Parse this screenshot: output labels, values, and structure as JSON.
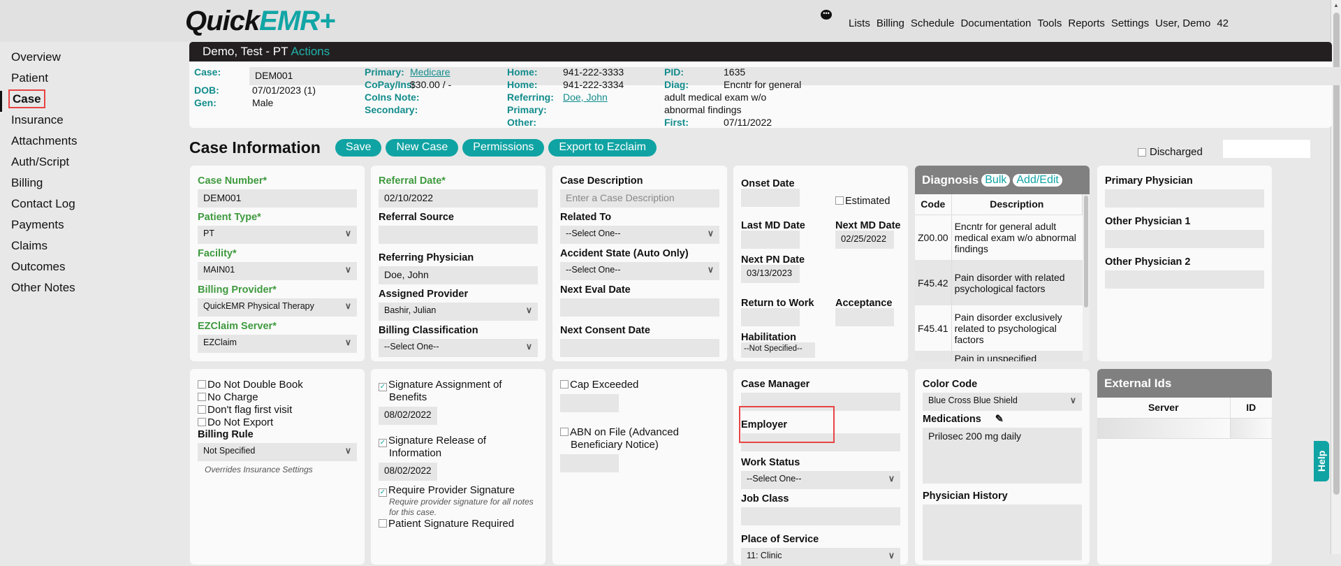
{
  "app": {
    "logo_a": "Quick",
    "logo_b": "EMR+",
    "brand_color": "#10a3a3"
  },
  "nav": [
    "Lists",
    "Billing",
    "Schedule",
    "Documentation",
    "Tools",
    "Reports",
    "Settings",
    "User, Demo",
    "42"
  ],
  "sidebar": [
    "Overview",
    "Patient",
    "Case",
    "Insurance",
    "Attachments",
    "Auth/Script",
    "Billing",
    "Contact Log",
    "Payments",
    "Claims",
    "Outcomes",
    "Other Notes"
  ],
  "patient": {
    "name": "Demo, Test - PT",
    "actions": "Actions"
  },
  "info": {
    "case_l": "Case:",
    "case": "DEM001",
    "dob_l": "DOB:",
    "dob": "07/01/2023 (1)",
    "gen_l": "Gen:",
    "gen": "Male",
    "primary_l": "Primary:",
    "primary": "Medicare",
    "copay_l": "CoPay/Ins:",
    "copay": "$30.00 / -",
    "coins_l": "CoIns Note:",
    "secondary_l": "Secondary:",
    "home1_l": "Home:",
    "home1": "941-222-3333",
    "home2_l": "Home:",
    "home2": "941-222-3334",
    "ref_l": "Referring:",
    "ref": "Doe, John",
    "prim_l": "Primary:",
    "other_l": "Other:",
    "pid_l": "PID:",
    "pid": "1635",
    "diag_l": "Diag:",
    "diag1": "Encntr for general",
    "diag2": "adult medical exam w/o",
    "diag3": "abnormal findings",
    "first_l": "First:",
    "first": "07/11/2022"
  },
  "case_info": {
    "title": "Case Information",
    "save": "Save",
    "new_case": "New Case",
    "permissions": "Permissions",
    "export": "Export to Ezclaim",
    "discharged": "Discharged"
  },
  "p1": {
    "case_number_l": "Case Number*",
    "case_number": "DEM001",
    "patient_type_l": "Patient Type*",
    "patient_type": "PT",
    "facility_l": "Facility*",
    "facility": "MAIN01",
    "billing_provider_l": "Billing Provider*",
    "billing_provider": "QuickEMR Physical Therapy",
    "ezclaim_l": "EZClaim Server*",
    "ezclaim": "EZClaim"
  },
  "p2": {
    "referral_date_l": "Referral Date*",
    "referral_date": "02/10/2022",
    "referral_source_l": "Referral Source",
    "ref_phys_l": "Referring Physician",
    "ref_phys": "Doe, John",
    "assigned_l": "Assigned Provider",
    "assigned": "Bashir, Julian",
    "billing_class_l": "Billing Classification",
    "billing_class": "--Select One--"
  },
  "p3": {
    "desc_l": "Case Description",
    "desc_ph": "Enter a Case Description",
    "related_l": "Related To",
    "related": "--Select One--",
    "accident_l": "Accident State (Auto Only)",
    "accident": "--Select One--",
    "next_eval_l": "Next Eval Date",
    "next_consent_l": "Next Consent Date"
  },
  "p4": {
    "onset_l": "Onset Date",
    "estimated": "Estimated",
    "last_md_l": "Last MD Date",
    "next_md_l": "Next MD Date",
    "next_md": "02/25/2022",
    "next_pn_l": "Next PN Date",
    "next_pn": "03/13/2023",
    "rtw_l": "Return to Work",
    "acceptance_l": "Acceptance",
    "habil_l": "Habilitation",
    "habil": "--Not Specified--"
  },
  "diagnosis": {
    "title": "Diagnosis",
    "bulk": "Bulk",
    "add_edit": "Add/Edit",
    "col_code": "Code",
    "col_desc": "Description",
    "rows": [
      {
        "code": "Z00.00",
        "desc": "Encntr for general adult medical exam w/o abnormal findings"
      },
      {
        "code": "F45.42",
        "desc": "Pain disorder with related psychological factors"
      },
      {
        "code": "F45.41",
        "desc": "Pain disorder exclusively related to psychological factors"
      },
      {
        "code": "",
        "desc": "Pain in unspecified"
      }
    ]
  },
  "p6": {
    "primary_l": "Primary Physician",
    "other1_l": "Other Physician 1",
    "other2_l": "Other Physician 2"
  },
  "r2p1": {
    "dndb": "Do Not Double Book",
    "nocharge": "No Charge",
    "noflag": "Don't flag first visit",
    "noexport": "Do Not Export",
    "billing_rule_l": "Billing Rule",
    "billing_rule": "Not Specified",
    "note": "Overrides Insurance Settings"
  },
  "r2p2": {
    "sig_assign": "Signature Assignment of Benefits",
    "sig_assign_date": "08/02/2022",
    "sig_release": "Signature Release of Information",
    "sig_release_date": "08/02/2022",
    "req_prov": "Require Provider Signature",
    "req_note": "Require provider signature for all notes for this case.",
    "pat_sig": "Patient Signature Required"
  },
  "r2p3": {
    "cap": "Cap Exceeded",
    "abn": "ABN on File (Advanced Beneficiary Notice)"
  },
  "r2p4": {
    "case_mgr_l": "Case Manager",
    "employer_l": "Employer",
    "work_status_l": "Work Status",
    "work_status": "--Select One--",
    "job_class_l": "Job Class",
    "pos_l": "Place of Service",
    "pos": "11: Clinic"
  },
  "r2p5": {
    "color_l": "Color Code",
    "color": "Blue Cross Blue Shield",
    "meds_l": "Medications",
    "meds": "Prilosec 200 mg daily",
    "phys_hist_l": "Physician History"
  },
  "ext": {
    "title": "External Ids",
    "col_server": "Server",
    "col_id": "ID"
  },
  "help": "Help"
}
